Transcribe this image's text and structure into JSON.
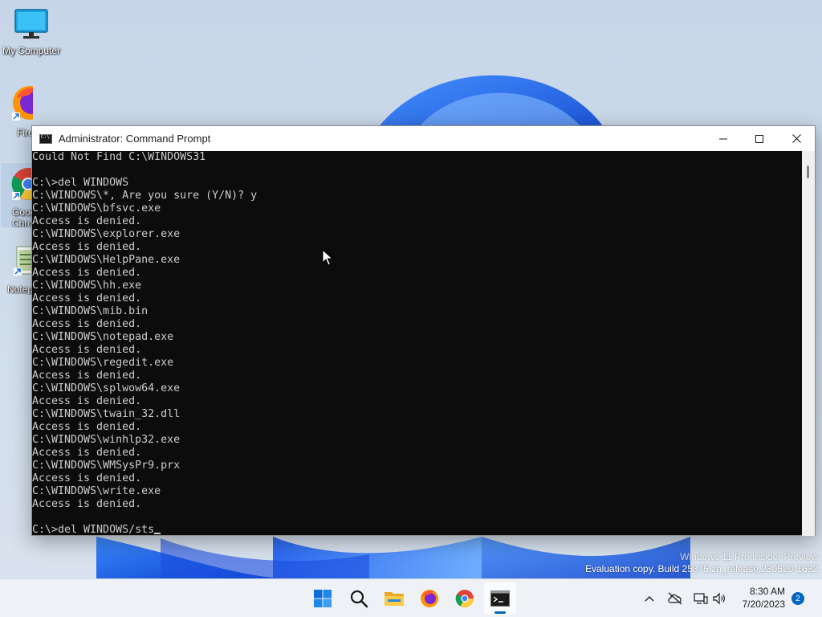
{
  "desktop": {
    "icons": [
      {
        "label": "My Computer",
        "icon": "monitor-icon"
      },
      {
        "label": "Firefox",
        "icon": "firefox-icon"
      },
      {
        "label": "Google Chrome",
        "icon": "chrome-icon"
      },
      {
        "label": "Notepad",
        "icon": "notepad-icon"
      }
    ],
    "watermark": {
      "line1": "Windows 11 Pro Insider Preview",
      "line2": "Evaluation copy. Build 25375.zn_release.230520-1632"
    }
  },
  "window": {
    "title": "Administrator:  Command Prompt",
    "controls": [
      "minimize",
      "maximize",
      "close"
    ]
  },
  "console": {
    "lines": [
      "Could Not Find C:\\WINDOWS31",
      "",
      "C:\\>del WINDOWS",
      "C:\\WINDOWS\\*, Are you sure (Y/N)? y",
      "C:\\WINDOWS\\bfsvc.exe",
      "Access is denied.",
      "C:\\WINDOWS\\explorer.exe",
      "Access is denied.",
      "C:\\WINDOWS\\HelpPane.exe",
      "Access is denied.",
      "C:\\WINDOWS\\hh.exe",
      "Access is denied.",
      "C:\\WINDOWS\\mib.bin",
      "Access is denied.",
      "C:\\WINDOWS\\notepad.exe",
      "Access is denied.",
      "C:\\WINDOWS\\regedit.exe",
      "Access is denied.",
      "C:\\WINDOWS\\splwow64.exe",
      "Access is denied.",
      "C:\\WINDOWS\\twain_32.dll",
      "Access is denied.",
      "C:\\WINDOWS\\winhlp32.exe",
      "Access is denied.",
      "C:\\WINDOWS\\WMSysPr9.prx",
      "Access is denied.",
      "C:\\WINDOWS\\write.exe",
      "Access is denied.",
      ""
    ],
    "prompt": "C:\\>del WINDOWS/sts"
  },
  "taskbar": {
    "apps": [
      "start-icon",
      "search-icon",
      "file-explorer-icon",
      "firefox-icon",
      "chrome-icon",
      "command-prompt-icon"
    ],
    "active_app": "command-prompt-icon",
    "clock": {
      "time": "8:30 AM",
      "date": "7/20/2023"
    },
    "notification_count": "2"
  },
  "colors": {
    "console_bg": "#0c0c0c",
    "console_fg": "#cccccc",
    "accent": "#0067c0"
  }
}
